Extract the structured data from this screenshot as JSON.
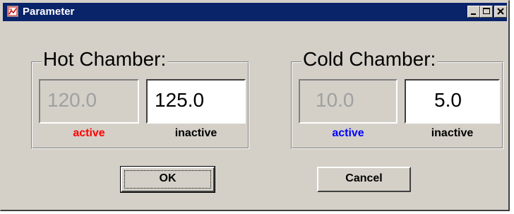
{
  "window": {
    "title": "Parameter",
    "icon": "chart-app-icon",
    "controls": [
      "minimize-icon",
      "maximize-icon",
      "close-icon"
    ]
  },
  "hot_chamber": {
    "title": "Hot Chamber:",
    "active_value": "120.0",
    "inactive_value": "125.0",
    "active_label": "active",
    "inactive_label": "inactive",
    "active_label_color": "#ff0000"
  },
  "cold_chamber": {
    "title": "Cold Chamber:",
    "active_value": "10.0",
    "inactive_value": "5.0",
    "active_label": "active",
    "inactive_label": "inactive",
    "active_label_color": "#0000ff"
  },
  "buttons": {
    "ok_label": "OK",
    "cancel_label": "Cancel"
  },
  "colors": {
    "titlebar": "#0a246a",
    "face": "#d4d0c8",
    "disabled_text": "#a0a0a0"
  }
}
